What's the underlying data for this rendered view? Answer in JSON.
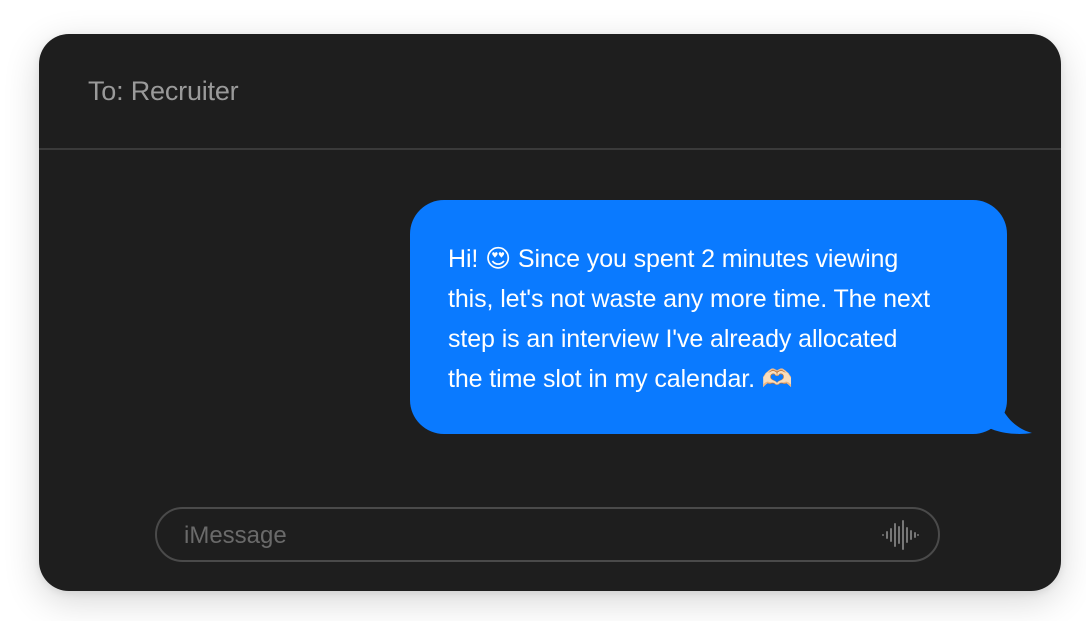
{
  "header": {
    "to_label": "To:",
    "recipient": "Recruiter"
  },
  "messages": [
    {
      "direction": "outgoing",
      "text": "Hi! 😍 Since you spent 2 minutes viewing this, let's not waste any more time. The next step is an interview I've already allocated the time slot in my calendar. 🫶🏻",
      "lines": [
        "Hi! 😍 Since you spent 2 minutes viewing",
        "this, let's not waste any more time. The next",
        "step is an interview I've already allocated",
        "the time slot in my calendar. 🫶🏻"
      ]
    }
  ],
  "composer": {
    "placeholder": "iMessage",
    "audio_icon": "waveform-icon"
  },
  "colors": {
    "background": "#1e1e1e",
    "bubble": "#0a7aff",
    "bubble_text": "#ffffff",
    "muted_text": "#9a9a9a"
  }
}
